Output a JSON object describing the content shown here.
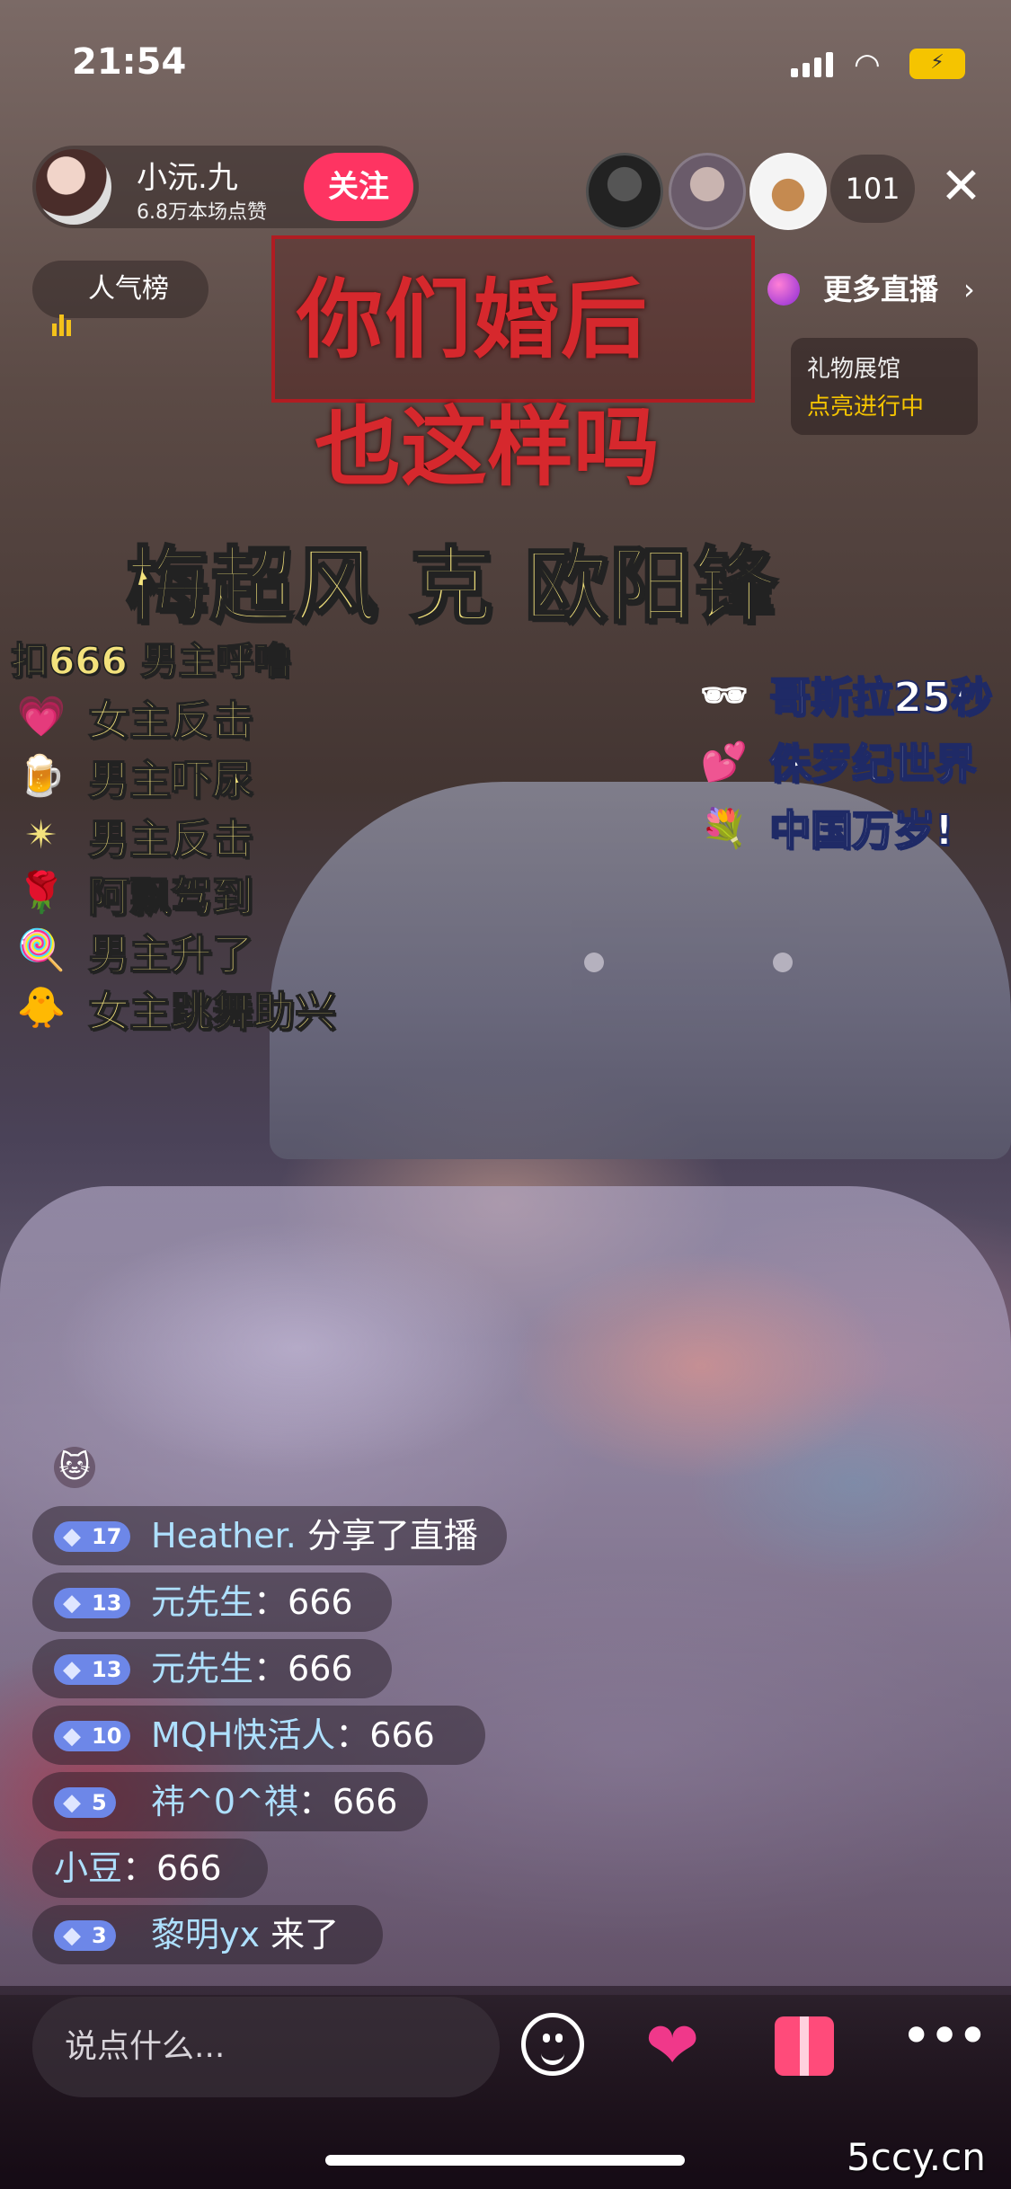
{
  "status_bar": {
    "time": "21:54"
  },
  "host": {
    "name": "小沅.九",
    "likes": "6.8万本场点赞",
    "follow_label": "关注"
  },
  "viewers": {
    "count": "101"
  },
  "rank": {
    "label": "人气榜"
  },
  "more_live": {
    "label": "更多直播",
    "chevron": "›"
  },
  "gift_hall": {
    "title": "礼物展馆",
    "status": "点亮进行中"
  },
  "poster": {
    "line1": "你们婚后",
    "line2": "也这样吗",
    "names": "梅超风 克 欧阳锋"
  },
  "gift_guide": {
    "title": "扣666 男主呼噜",
    "left_items": [
      {
        "icon": "heart-gift-icon",
        "glyph": "💗",
        "label": "女主反击"
      },
      {
        "icon": "beer-gift-icon",
        "glyph": "🍺",
        "label": "男主吓尿"
      },
      {
        "icon": "star-gift-icon",
        "glyph": "✴",
        "label": "男主反击"
      },
      {
        "icon": "rose-bouquet-gift-icon",
        "glyph": "🌹",
        "label": "阿飘驾到"
      },
      {
        "icon": "lollipop-gift-icon",
        "glyph": "🍭",
        "label": "男主升了"
      },
      {
        "icon": "duck-gift-icon",
        "glyph": "🐥",
        "label": "女主跳舞助兴"
      }
    ],
    "right_items": [
      {
        "icon": "sunglasses-gift-icon",
        "glyph": "🕶",
        "label": "哥斯拉25秒"
      },
      {
        "icon": "hearts-gift-icon",
        "glyph": "💕",
        "label": "侏罗纪世界"
      },
      {
        "icon": "bouquet-gift-icon",
        "glyph": "💐",
        "label": "中国万岁!"
      }
    ]
  },
  "chat": [
    {
      "level": "17",
      "name": "Heather.",
      "text": "分享了直播"
    },
    {
      "level": "13",
      "name": "元先生",
      "text": "：666"
    },
    {
      "level": "13",
      "name": "元先生",
      "text": "：666"
    },
    {
      "level": "10",
      "name": "MQH快活人",
      "text": "：666"
    },
    {
      "level": "5",
      "name": "祎^0^祺",
      "text": "：666"
    },
    {
      "level": "",
      "name": "小豆",
      "text": "：666"
    },
    {
      "level": "3",
      "name": "黎明yx",
      "text": "来了"
    }
  ],
  "input": {
    "placeholder": "说点什么..."
  },
  "watermark": "5ccy.cn",
  "colors": {
    "accent": "#fe3462",
    "badge": "#6d87e8",
    "gift_text": "#f3e27c"
  }
}
